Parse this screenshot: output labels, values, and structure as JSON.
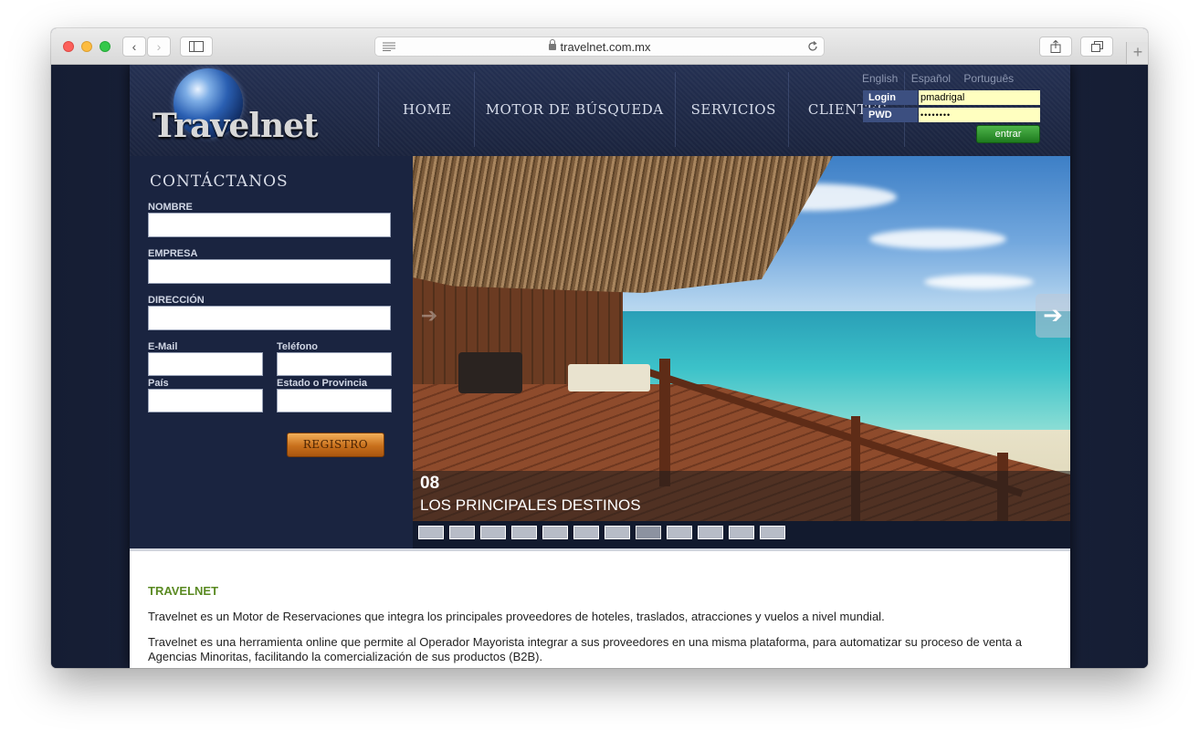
{
  "browser": {
    "url": "travelnet.com.mx",
    "back_icon": "chevron-left-icon",
    "forward_icon": "chevron-right-icon"
  },
  "header": {
    "logo_text": "Travelnet",
    "nav": [
      "HOME",
      "MOTOR DE BÚSQUEDA",
      "SERVICIOS",
      "CLIENTES"
    ],
    "languages": [
      "English",
      "Español",
      "Português"
    ],
    "login": {
      "login_label": "Login",
      "login_value": "pmadrigal",
      "pwd_label": "PWD",
      "pwd_value": "••••••••",
      "submit_label": "entrar"
    }
  },
  "contact": {
    "title": "CONTÁCTANOS",
    "fields": {
      "nombre": "NOMBRE",
      "empresa": "EMPRESA",
      "direccion": "DIRECCIÓN",
      "email": "E-Mail",
      "telefono": "Teléfono",
      "pais": "País",
      "estado": "Estado o Provincia"
    },
    "submit_label": "REGISTRO"
  },
  "slider": {
    "number": "08",
    "caption": "LOS PRINCIPALES DESTINOS",
    "slide_count": 12,
    "active_slide": 8
  },
  "content": {
    "heading": "TRAVELNET",
    "paragraphs": [
      "Travelnet es un Motor de Reservaciones que integra los principales proveedores de hoteles, traslados, atracciones y vuelos a nivel mundial.",
      "Travelnet es una herramienta online que permite al Operador Mayorista integrar a sus proveedores en una misma plataforma, para automatizar su proceso de venta a Agencias Minoritas, facilitando la comercialización de sus productos (B2B)."
    ]
  },
  "colors": {
    "accent_green": "#5a8a22",
    "header_bg": "#1a233d",
    "login_input_bg": "#ffffc0"
  }
}
